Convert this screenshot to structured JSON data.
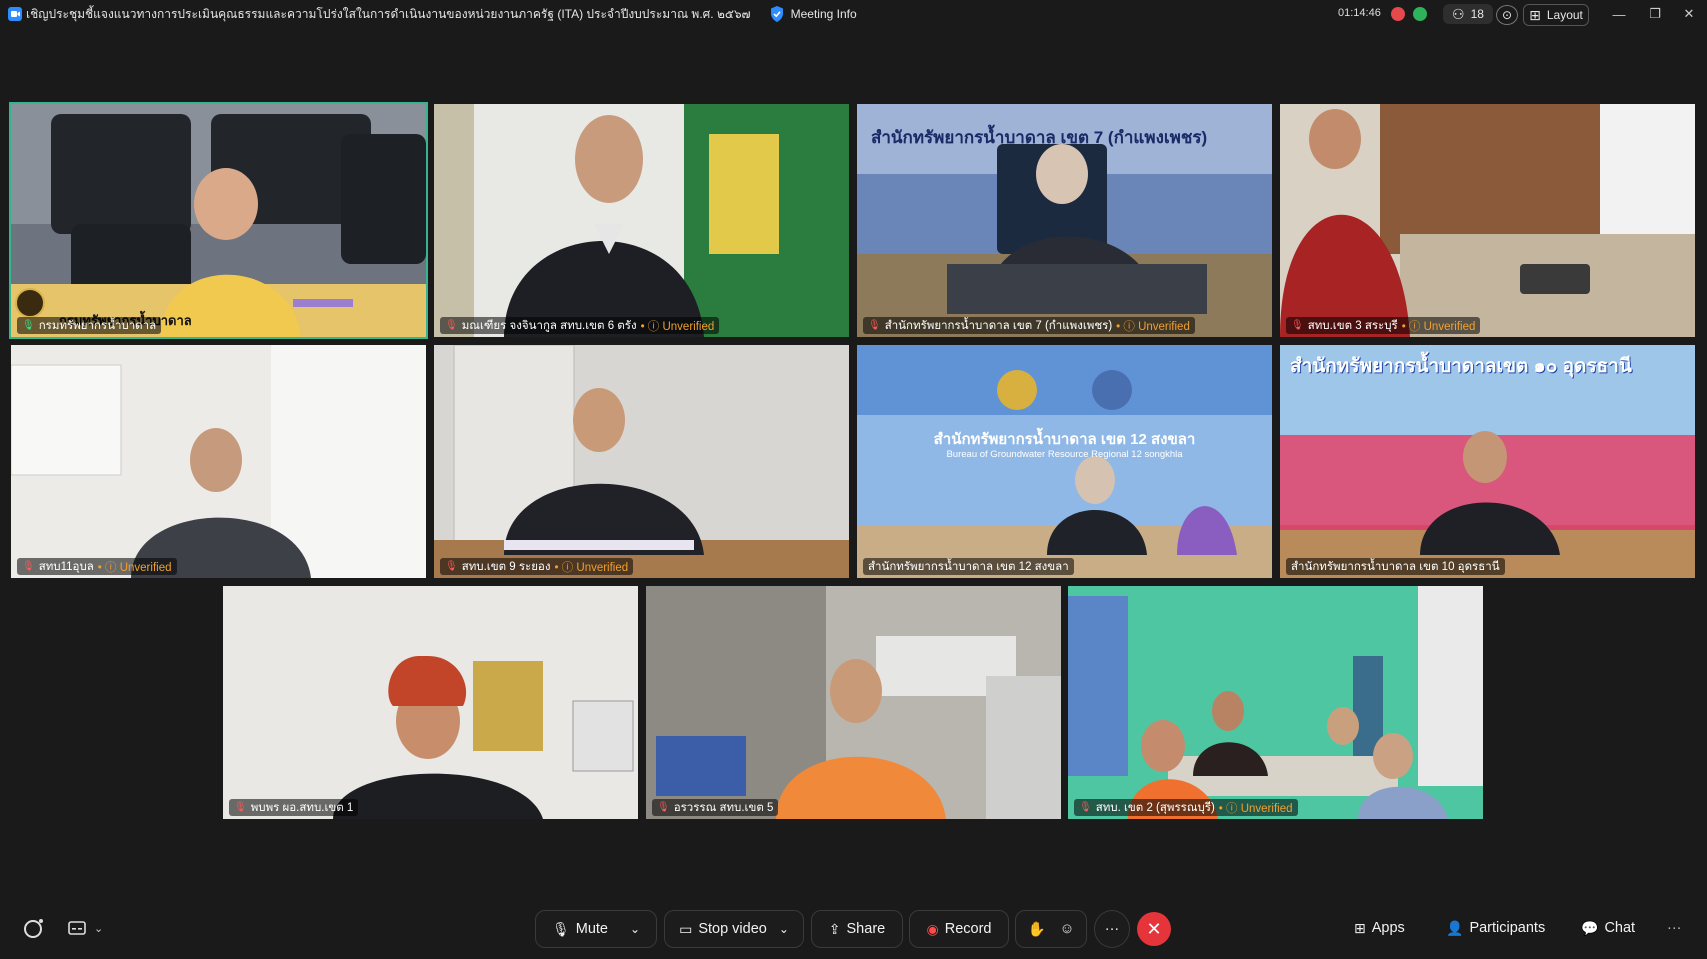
{
  "titlebar": {
    "meeting_title": "เชิญประชุมชี้แจงแนวทางการประเมินคุณธรรมและความโปร่งใสในการดำเนินงานของหน่วยงานภาครัฐ (ITA) ประจำปีงบประมาณ พ.ศ. ๒๕๖๗",
    "meeting_info_label": "Meeting Info",
    "timer": "01:14:46",
    "participant_count": "18",
    "layout_label": "Layout"
  },
  "tiles": [
    {
      "name": "กรมทรัพยากรน้ำบาดาล",
      "unverified": "",
      "banner": "กรมทรัพยากรน้ำบาดาล"
    },
    {
      "name": "มณเฑียร จงจินากูล สทบ.เขต 6 ตรัง",
      "unverified": "Unverified"
    },
    {
      "name": "สำนักทรัพยากรน้ำบาดาล เขต 7 (กำแพงเพชร)",
      "unverified": "Unverified",
      "banner": "สำนักทรัพยากรน้ำบาดาล เขต 7 (กำแพงเพชร)"
    },
    {
      "name": "สทบ.เขต 3 สระบุรี",
      "unverified": "Unverified"
    },
    {
      "name": "สทบ11อุบล",
      "unverified": "Unverified"
    },
    {
      "name": "สทบ.เขต 9 ระยอง",
      "unverified": "Unverified"
    },
    {
      "name": "สำนักทรัพยากรน้ำบาดาล เขต 12 สงขลา",
      "unverified": "",
      "banner": "สำนักทรัพยากรน้ำบาดาล เขต 12 สงขลา",
      "banner_en": "Bureau of Groundwater Resource Regional 12 songkhla"
    },
    {
      "name": "สำนักทรัพยากรน้ำบาดาล เขต 10 อุดรธานี",
      "unverified": "",
      "banner": "สำนักทรัพยากรน้ำบาดาลเขต ๑๐ อุดรธานี"
    },
    {
      "name": "พบพร ผอ.สทบ.เขต 1",
      "unverified": ""
    },
    {
      "name": "อรวรรณ สทบ.เขต 5",
      "unverified": ""
    },
    {
      "name": "สทบ. เขต 2 (สุพรรณบุรี)",
      "unverified": "Unverified"
    }
  ],
  "toolbar": {
    "mute": "Mute",
    "stop_video": "Stop video",
    "share": "Share",
    "record": "Record",
    "apps": "Apps",
    "participants": "Participants",
    "chat": "Chat"
  },
  "colors": {
    "active_speaker": "#36b48f",
    "end_call": "#e5343a",
    "unverified": "#f0a030"
  }
}
